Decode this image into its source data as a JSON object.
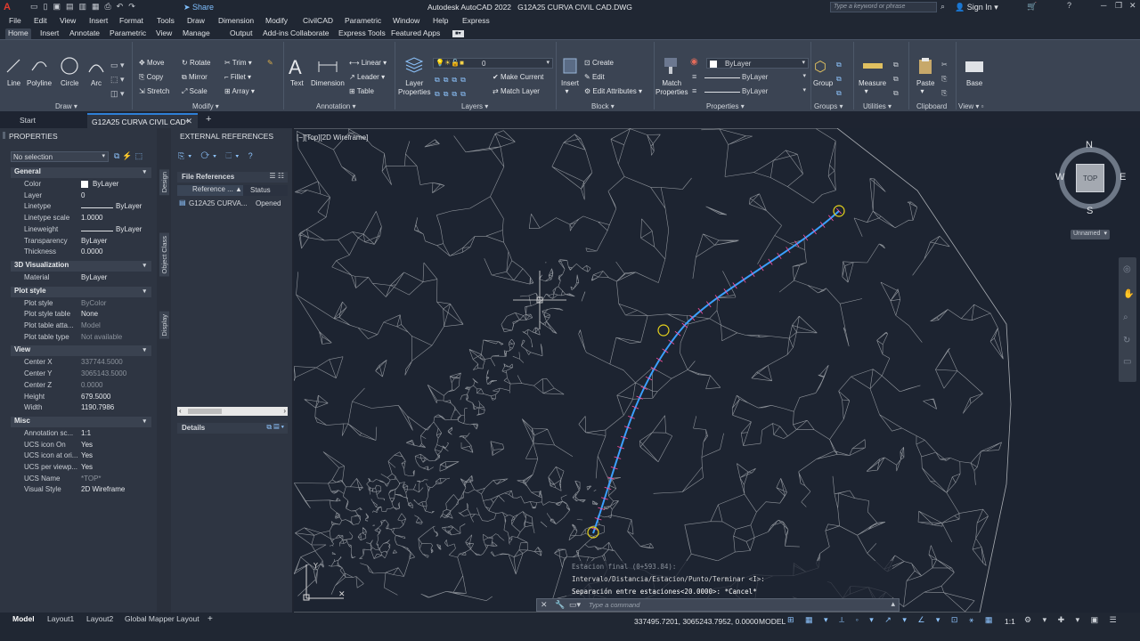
{
  "app": {
    "title": "Autodesk AutoCAD 2022   G12A25 CURVA CIVIL CAD.DWG",
    "share_label": "Share",
    "search_placeholder": "Type a keyword or phrase",
    "sign_in": "Sign In"
  },
  "menu": [
    "File",
    "Edit",
    "View",
    "Insert",
    "Format",
    "Tools",
    "Draw",
    "Dimension",
    "Modify",
    "CivilCAD",
    "Parametric",
    "Window",
    "Help",
    "Express"
  ],
  "ribbon_tabs": [
    "Home",
    "Insert",
    "Annotate",
    "Parametric",
    "View",
    "Manage",
    "Output",
    "Add-ins",
    "Collaborate",
    "Express Tools",
    "Featured Apps"
  ],
  "ribbon": {
    "draw": {
      "line": "Line",
      "polyline": "Polyline",
      "circle": "Circle",
      "arc": "Arc",
      "group": "Draw"
    },
    "modify": {
      "move": "Move",
      "rotate": "Rotate",
      "trim": "Trim",
      "copy": "Copy",
      "mirror": "Mirror",
      "fillet": "Fillet",
      "stretch": "Stretch",
      "scale": "Scale",
      "array": "Array",
      "group": "Modify"
    },
    "annotation": {
      "text": "Text",
      "dimension": "Dimension",
      "linear": "Linear",
      "leader": "Leader",
      "table": "Table",
      "group": "Annotation"
    },
    "layers": {
      "layer_properties": "Layer Properties",
      "layer_value": "0",
      "make_current": "Make Current",
      "match_layer": "Match Layer",
      "group": "Layers"
    },
    "block": {
      "insert": "Insert",
      "create": "Create",
      "edit": "Edit",
      "edit_attributes": "Edit Attributes",
      "group": "Block"
    },
    "properties": {
      "match": "Match Properties",
      "bylayer1": "ByLayer",
      "bylayer2": "ByLayer",
      "bylayer3": "ByLayer",
      "group": "Properties"
    },
    "groups": {
      "group": "Group",
      "label": "Groups"
    },
    "utilities": {
      "measure": "Measure",
      "label": "Utilities"
    },
    "clipboard": {
      "paste": "Paste",
      "label": "Clipboard"
    },
    "view": {
      "base": "Base",
      "label": "View"
    }
  },
  "doc_tabs": {
    "start": "Start",
    "active": "G12A25 CURVA CIVIL CAD*"
  },
  "properties_panel": {
    "title": "PROPERTIES",
    "selection": "No selection",
    "sections": {
      "general": "General",
      "visualization": "3D Visualization",
      "plot_style": "Plot style",
      "view": "View",
      "misc": "Misc"
    },
    "general": [
      {
        "name": "Color",
        "value": "ByLayer"
      },
      {
        "name": "Layer",
        "value": "0"
      },
      {
        "name": "Linetype",
        "value": "ByLayer"
      },
      {
        "name": "Linetype scale",
        "value": "1.0000"
      },
      {
        "name": "Lineweight",
        "value": "ByLayer"
      },
      {
        "name": "Transparency",
        "value": "ByLayer"
      },
      {
        "name": "Thickness",
        "value": "0.0000"
      }
    ],
    "visualization": [
      {
        "name": "Material",
        "value": "ByLayer"
      }
    ],
    "plot_style": [
      {
        "name": "Plot style",
        "value": "ByColor"
      },
      {
        "name": "Plot style table",
        "value": "None"
      },
      {
        "name": "Plot table atta...",
        "value": "Model"
      },
      {
        "name": "Plot table type",
        "value": "Not available"
      }
    ],
    "view": [
      {
        "name": "Center X",
        "value": "337744.5000"
      },
      {
        "name": "Center Y",
        "value": "3065143.5000"
      },
      {
        "name": "Center Z",
        "value": "0.0000"
      },
      {
        "name": "Height",
        "value": "679.5000"
      },
      {
        "name": "Width",
        "value": "1190.7986"
      }
    ],
    "misc": [
      {
        "name": "Annotation sc...",
        "value": "1:1"
      },
      {
        "name": "UCS icon On",
        "value": "Yes"
      },
      {
        "name": "UCS icon at ori...",
        "value": "Yes"
      },
      {
        "name": "UCS per viewp...",
        "value": "Yes"
      },
      {
        "name": "UCS Name",
        "value": "*TOP*"
      },
      {
        "name": "Visual Style",
        "value": "2D Wireframe"
      }
    ],
    "side_tabs": [
      "Design",
      "Object Class",
      "Display"
    ]
  },
  "xref_panel": {
    "title": "EXTERNAL REFERENCES",
    "file_refs": "File References",
    "col_ref": "Reference ...",
    "col_status": "Status",
    "row_name": "G12A25 CURVA...",
    "row_status": "Opened",
    "details": "Details"
  },
  "viewport": {
    "label": "[−][Top][2D Wireframe]",
    "compass": {
      "n": "N",
      "s": "S",
      "e": "E",
      "w": "W",
      "top": "TOP"
    },
    "ucs_name": "Unnamed"
  },
  "command": {
    "history1": "Estacion final (0+593.84):",
    "history2": "Intervalo/Distancia/Estacion/Punto/Terminar <I>:",
    "history3": "Separación entre estaciones<20.0000>: *Cancel*",
    "placeholder": "Type a command"
  },
  "layout_tabs": [
    "Model",
    "Layout1",
    "Layout2",
    "Global Mapper Layout"
  ],
  "status": {
    "coords": "337495.7201, 3065243.7952, 0.0000",
    "mode": "MODEL",
    "scale": "1:1"
  },
  "colors": {
    "accent": "#2e7fd6",
    "alignment": "#3aa0ff",
    "mesh": "#8f949b",
    "station": "#ff4fa3",
    "marker": "#e6d21c"
  }
}
